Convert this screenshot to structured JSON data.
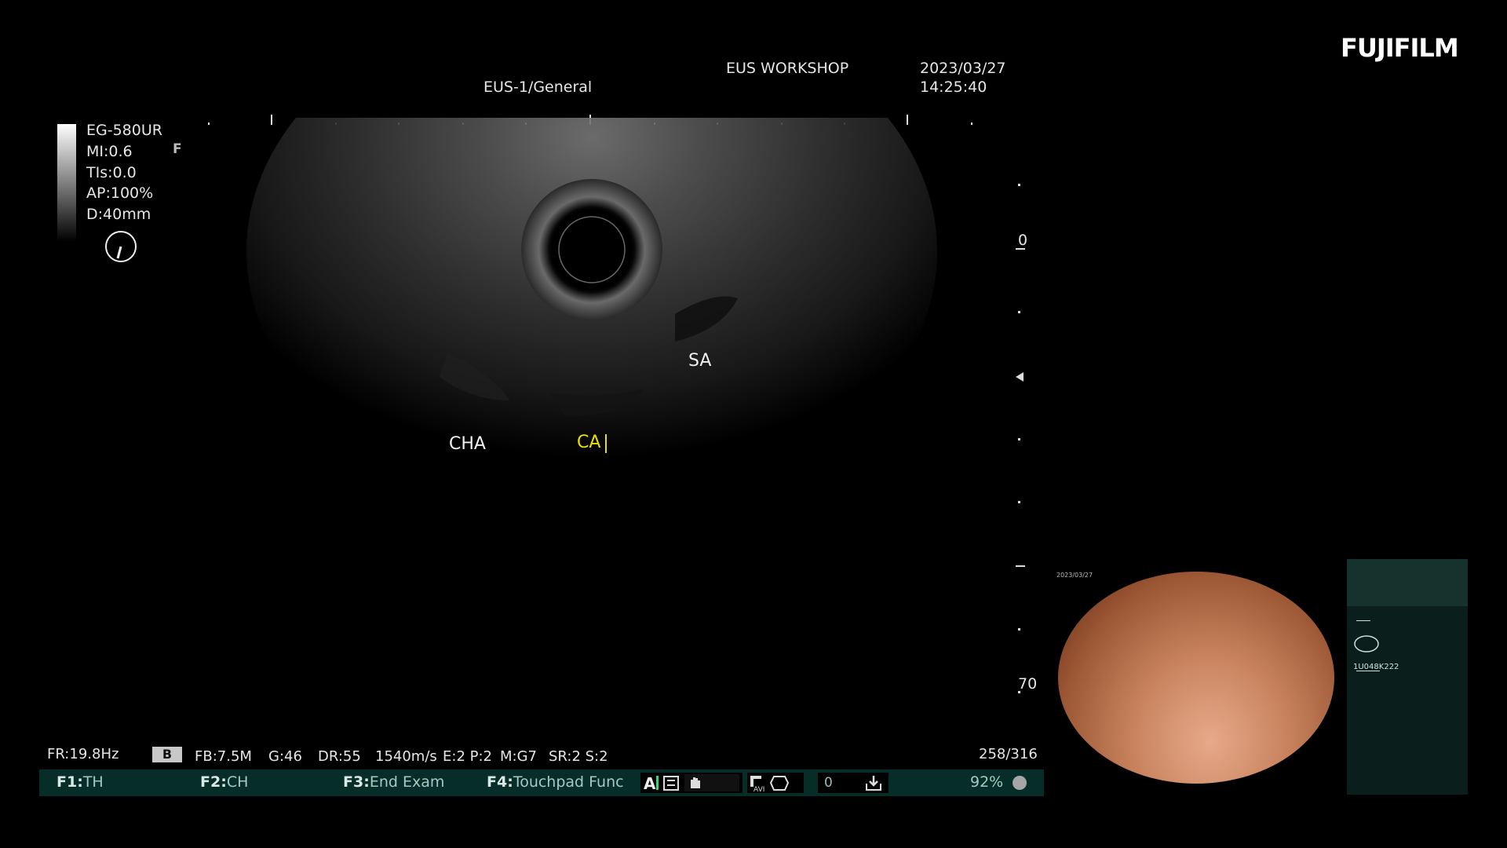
{
  "brand": "FUJIFILM",
  "header": {
    "preset": "EUS-1/General",
    "institution": "EUS WORKSHOP",
    "date": "2023/03/27",
    "time": "14:25:40"
  },
  "probe_info": {
    "model": "EG-580UR",
    "mi": "MI:0.6",
    "tis": "TIs:0.0",
    "ap": "AP:100%",
    "depth": "D:40mm",
    "focus_mark": "F"
  },
  "depth_scale": {
    "top": "0",
    "bottom": "70"
  },
  "annotations": [
    {
      "text": "SA",
      "color": "#f0f0f0"
    },
    {
      "text": "CHA",
      "color": "#f0f0f0"
    },
    {
      "text": "CA",
      "color": "#e8e000"
    }
  ],
  "status_bar": {
    "frame_rate": "FR:19.8Hz",
    "mode": "B",
    "fb": "FB:7.5M",
    "gain": "G:46",
    "dr": "DR:55",
    "speed": "1540m/s",
    "ep": "E:2 P:2",
    "mg": "M:G7",
    "sr": "SR:2 S:2",
    "frame_count": "258/316"
  },
  "function_bar": {
    "f1_key": "F1:",
    "f1_label": "TH",
    "f2_key": "F2:",
    "f2_label": "CH",
    "f3_key": "F3:",
    "f3_label": "End Exam",
    "f4_key": "F4:",
    "f4_label": "Touchpad Func",
    "counter": "0",
    "percent": "92%",
    "icons": [
      "text-cursor-icon",
      "cine-film-icon",
      "hand-icon",
      "avi-record-icon",
      "body-mark-icon",
      "save-download-icon"
    ]
  },
  "pip": {
    "date": "2023/03/27",
    "serial": "1U048K222"
  },
  "colors": {
    "background": "#000000",
    "function_bar": "#062d28",
    "annotation_yellow": "#e8e000",
    "pip_tissue": "#c9845f"
  }
}
